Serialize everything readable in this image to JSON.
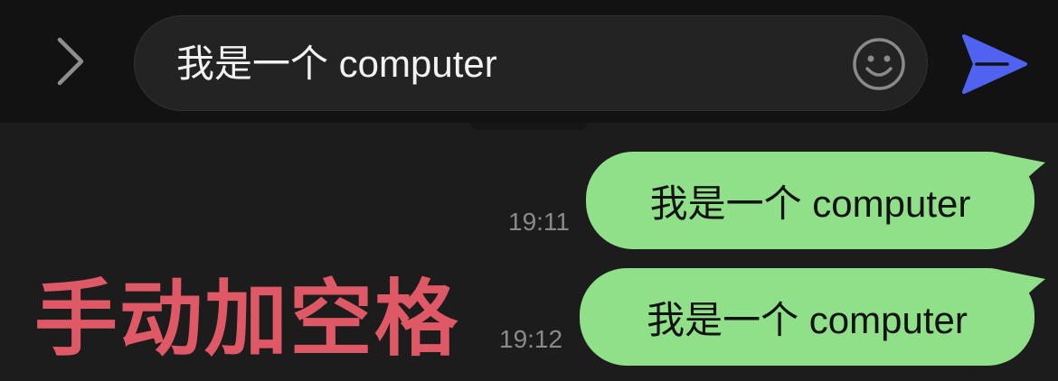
{
  "input_bar": {
    "text": "我是一个 computer",
    "icons": {
      "expand": "chevron-right-icon",
      "emoji": "smiley-icon",
      "send": "send-arrow-icon"
    },
    "colors": {
      "send": "#4f63f0",
      "icon_gray": "#8a8a8a"
    }
  },
  "messages": [
    {
      "text": "我是一个 computer",
      "time": "19:11"
    },
    {
      "text": "我是一个 computer",
      "time": "19:12"
    }
  ],
  "annotation": "手动加空格",
  "colors": {
    "bubble": "#8fe088",
    "annotation": "#df5866",
    "background": "#1c1c1c"
  }
}
